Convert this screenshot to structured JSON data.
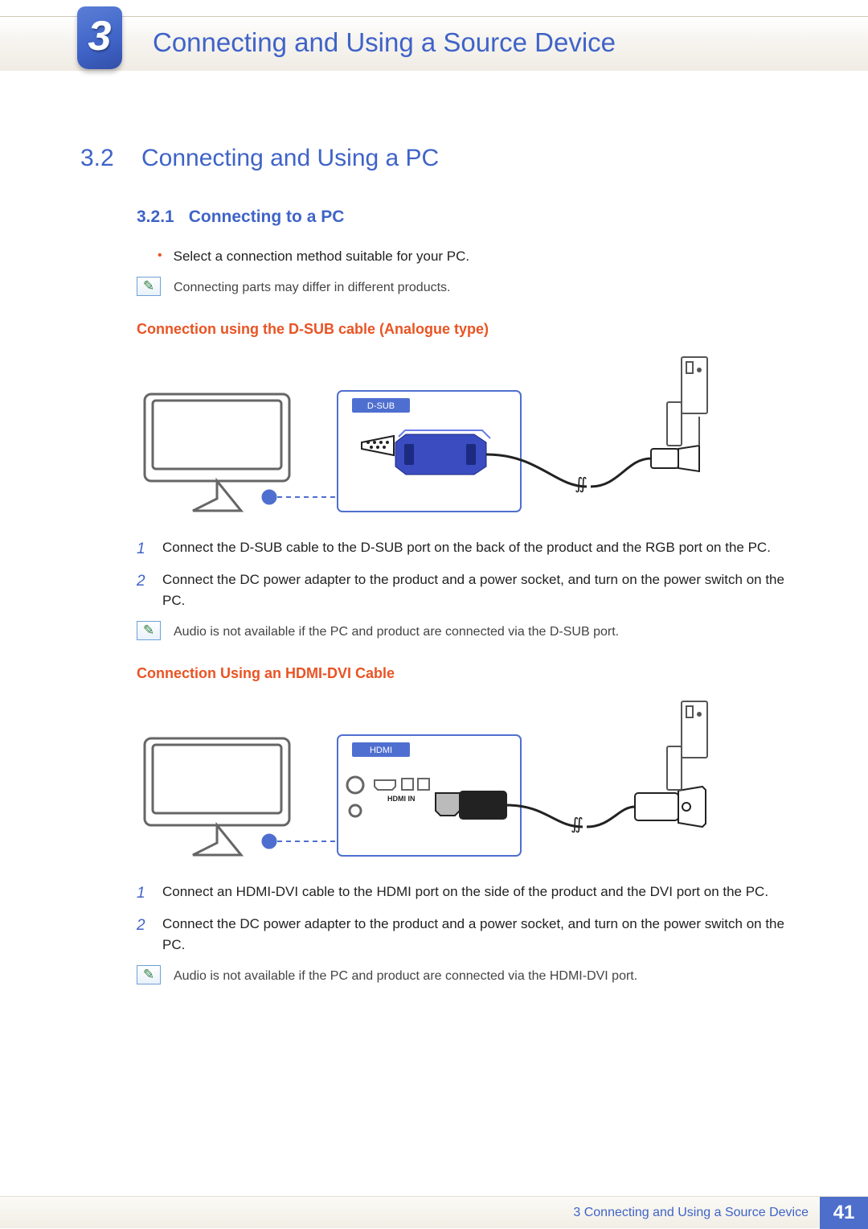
{
  "chapter": {
    "number": "3",
    "title": "Connecting and Using a Source Device"
  },
  "section": {
    "number": "3.2",
    "title": "Connecting and Using a PC"
  },
  "subsection": {
    "number": "3.2.1",
    "title": "Connecting to a PC"
  },
  "intro": {
    "bullet": "Select a connection method suitable for your PC.",
    "note": "Connecting parts may differ in different products."
  },
  "dsub": {
    "heading": "Connection using the D-SUB cable (Analogue type)",
    "port_label": "D-SUB",
    "steps": [
      "Connect the D-SUB cable to the D-SUB port on the back of the product and the RGB port on the PC.",
      "Connect the DC power adapter to the product and a power socket, and turn on the power switch on the PC."
    ],
    "note": "Audio is not available if the PC and product are connected via the D-SUB port."
  },
  "hdmi": {
    "heading": "Connection Using an HDMI-DVI Cable",
    "port_label": "HDMI",
    "port_in_label": "HDMI IN",
    "steps": [
      "Connect an HDMI-DVI cable to the HDMI port on the side of the product and the DVI port on the PC.",
      "Connect the DC power adapter to the product and a power socket, and turn on the power switch on the PC."
    ],
    "note": "Audio is not available if the PC and product are connected via the HDMI-DVI port."
  },
  "footer": {
    "text": "3 Connecting and Using a Source Device",
    "page": "41"
  },
  "step_numbers": {
    "one": "1",
    "two": "2"
  }
}
